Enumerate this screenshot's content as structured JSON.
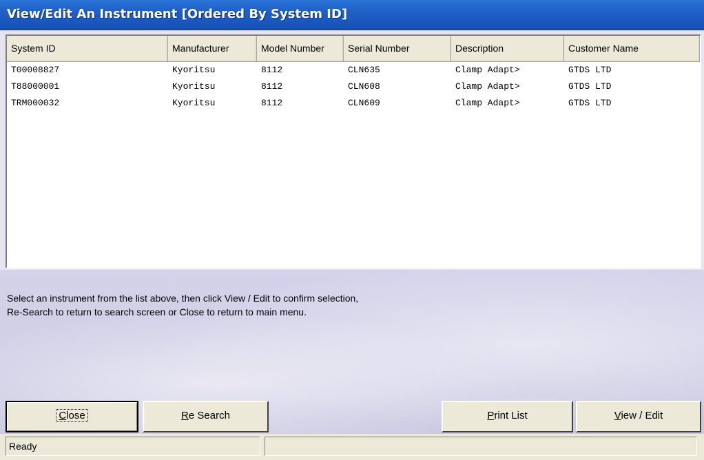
{
  "window": {
    "title": "View/Edit An Instrument [Ordered By System ID]"
  },
  "list": {
    "columns": [
      "System ID",
      "Manufacturer",
      "Model Number",
      "Serial Number",
      "Description",
      "Customer Name"
    ],
    "rows": [
      [
        "T00008827",
        "Kyoritsu",
        "8112",
        "CLN635",
        "Clamp Adapt>",
        "GTDS LTD"
      ],
      [
        "T88000001",
        "Kyoritsu",
        "8112",
        "CLN608",
        "Clamp Adapt>",
        "GTDS LTD"
      ],
      [
        "TRM000032",
        "Kyoritsu",
        "8112",
        "CLN609",
        "Clamp Adapt>",
        "GTDS LTD"
      ]
    ]
  },
  "instructions": {
    "line1": "Select an instrument from the list above, then click View / Edit to confirm selection,",
    "line2": "Re-Search to return to search screen or Close to return to main menu."
  },
  "buttons": {
    "close": {
      "mnemonic": "C",
      "rest": "lose"
    },
    "re_search": {
      "mnemonic": "R",
      "rest": "e Search"
    },
    "print_list": {
      "mnemonic": "P",
      "rest": "rint List"
    },
    "view_edit": {
      "mnemonic": "V",
      "rest": "iew / Edit"
    }
  },
  "status": {
    "text": "Ready",
    "secondary": ""
  }
}
